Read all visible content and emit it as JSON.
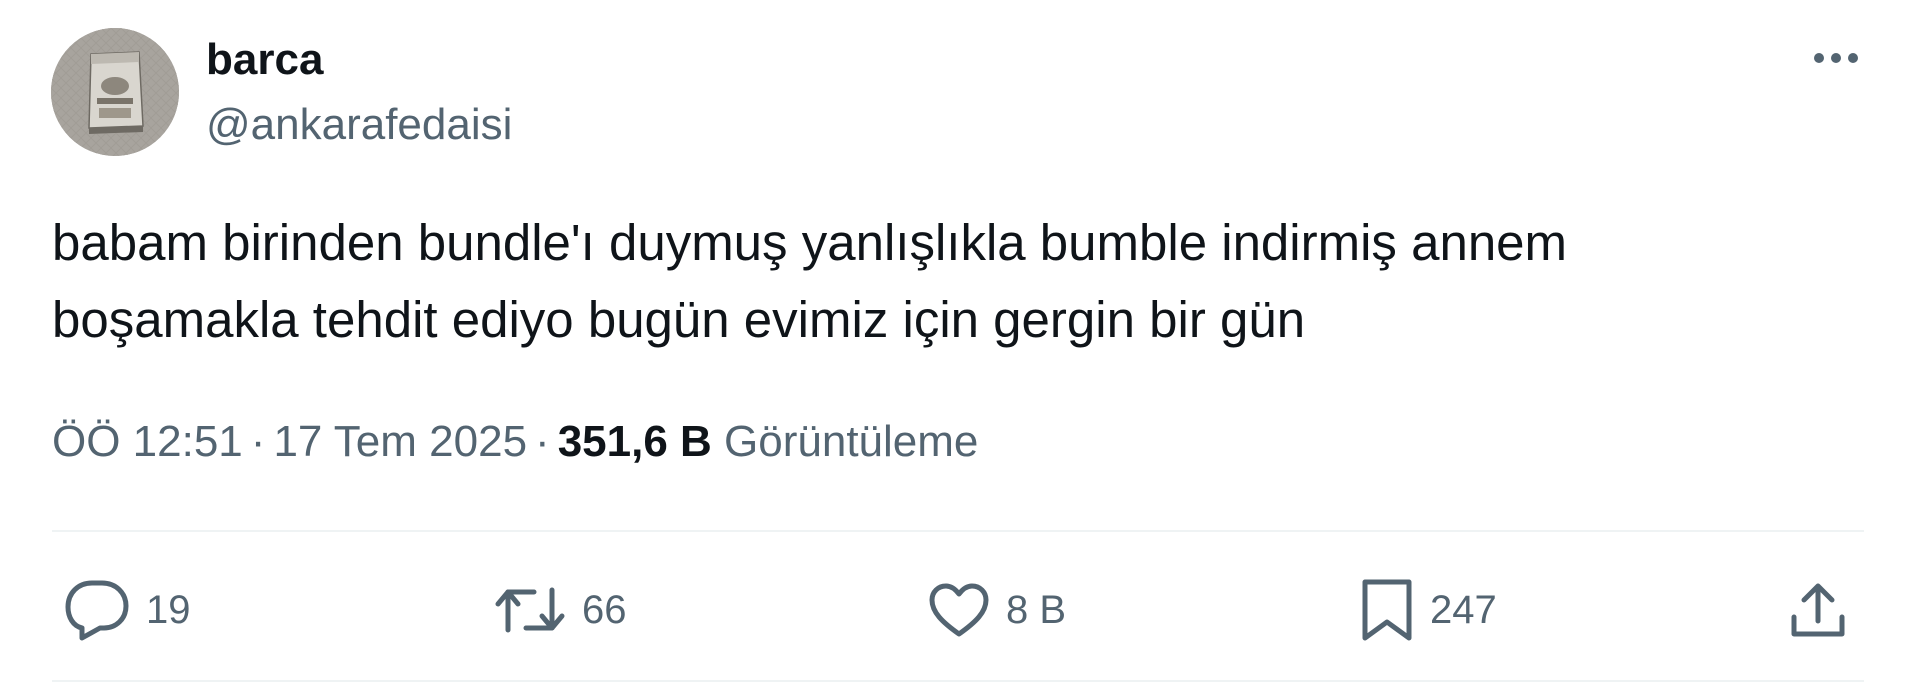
{
  "author": {
    "display_name": "barca",
    "handle": "@ankarafedaisi",
    "avatar_icon": "snack-bag-avatar"
  },
  "menu": {
    "icon": "more-horizontal-icon"
  },
  "tweet": {
    "text": "babam birinden bundle'ı duymuş yanlışlıkla bumble indirmiş annem\nboşamakla tehdit ediyo bugün evimiz için gergin bir gün"
  },
  "meta": {
    "time": "ÖÖ 12:51",
    "separator": "·",
    "date": "17 Tem 2025",
    "views_count": "351,6 B",
    "views_label": "Görüntüleme"
  },
  "actions": {
    "reply": {
      "icon": "reply-icon",
      "count": "19"
    },
    "retweet": {
      "icon": "retweet-icon",
      "count": "66"
    },
    "like": {
      "icon": "heart-icon",
      "count": "8 B"
    },
    "bookmark": {
      "icon": "bookmark-icon",
      "count": "247"
    },
    "share": {
      "icon": "share-icon"
    }
  },
  "colors": {
    "text_primary": "#0f1419",
    "text_secondary": "#536471",
    "divider": "#eff3f4",
    "background": "#ffffff"
  }
}
